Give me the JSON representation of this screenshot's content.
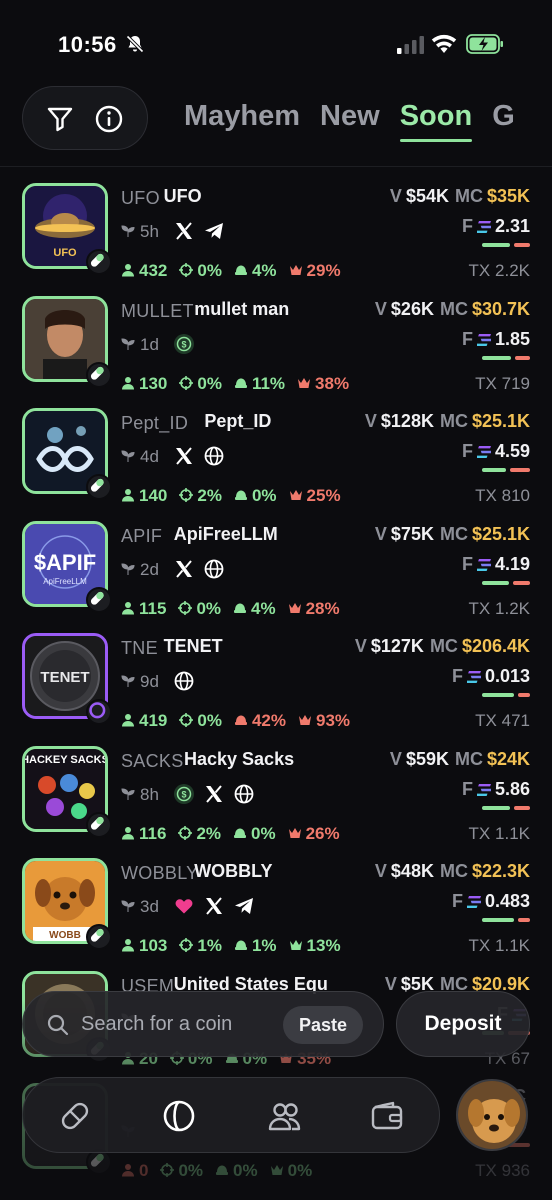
{
  "status_bar": {
    "time": "10:56"
  },
  "header": {
    "tabs": [
      "Mayhem",
      "New",
      "Soon",
      "G"
    ],
    "active_tab": "Soon"
  },
  "coins": [
    {
      "ticker": "UFO",
      "name": "UFO",
      "age": "5h",
      "socials": [
        "x-icon",
        "telegram-icon"
      ],
      "volume": "$54K",
      "mc": "$35K",
      "fee": "2.31",
      "holders": "432",
      "snipers": "0%",
      "insiders": "4%",
      "top10": "29%",
      "insiders_red": false,
      "top10_red": true,
      "tx": "2.2K",
      "border": "green",
      "bar_green": 0.62
    },
    {
      "ticker": "MULLET",
      "name": "mullet man",
      "age": "1d",
      "socials": [
        "dollar-icon"
      ],
      "volume": "$26K",
      "mc": "$30.7K",
      "fee": "1.85",
      "holders": "130",
      "snipers": "0%",
      "insiders": "11%",
      "top10": "38%",
      "insiders_red": false,
      "top10_red": true,
      "tx": "719",
      "border": "green",
      "bar_green": 0.65
    },
    {
      "ticker": "Pept_ID",
      "name": "Pept_ID",
      "age": "4d",
      "socials": [
        "x-icon",
        "globe-icon"
      ],
      "volume": "$128K",
      "mc": "$25.1K",
      "fee": "4.59",
      "holders": "140",
      "snipers": "2%",
      "insiders": "0%",
      "top10": "25%",
      "insiders_red": false,
      "top10_red": true,
      "tx": "810",
      "border": "green",
      "bar_green": 0.55
    },
    {
      "ticker": "APIF",
      "name": "ApiFreeLLM",
      "age": "2d",
      "socials": [
        "x-icon",
        "globe-icon"
      ],
      "volume": "$75K",
      "mc": "$25.1K",
      "fee": "4.19",
      "holders": "115",
      "snipers": "0%",
      "insiders": "4%",
      "top10": "28%",
      "insiders_red": false,
      "top10_red": true,
      "tx": "1.2K",
      "border": "green",
      "bar_green": 0.6
    },
    {
      "ticker": "TNE",
      "name": "TENET",
      "age": "9d",
      "socials": [
        "globe-icon"
      ],
      "volume": "$127K",
      "mc": "$206.4K",
      "fee": "0.013",
      "holders": "419",
      "snipers": "0%",
      "insiders": "42%",
      "top10": "93%",
      "insiders_red": true,
      "top10_red": true,
      "tx": "471",
      "border": "purple",
      "bar_green": 0.7
    },
    {
      "ticker": "SACKS",
      "name": "Hacky Sacks",
      "age": "8h",
      "socials": [
        "dollar-icon",
        "x-icon",
        "globe-icon"
      ],
      "volume": "$59K",
      "mc": "$24K",
      "fee": "5.86",
      "holders": "116",
      "snipers": "2%",
      "insiders": "0%",
      "top10": "26%",
      "insiders_red": false,
      "top10_red": true,
      "tx": "1.1K",
      "border": "green",
      "bar_green": 0.62
    },
    {
      "ticker": "WOBBLY",
      "name": "WOBBLY",
      "age": "3d",
      "socials": [
        "heart-icon",
        "x-icon",
        "telegram-icon"
      ],
      "volume": "$48K",
      "mc": "$22.3K",
      "fee": "0.483",
      "holders": "103",
      "snipers": "1%",
      "insiders": "1%",
      "top10": "13%",
      "insiders_red": false,
      "top10_red": false,
      "tx": "1.1K",
      "border": "green",
      "bar_green": 0.7
    },
    {
      "ticker": "USEM",
      "name": "United States Equ",
      "age": "",
      "socials": [],
      "volume": "$5K",
      "mc": "$20.9K",
      "fee": "",
      "holders": "20",
      "snipers": "0%",
      "insiders": "0%",
      "top10": "35%",
      "insiders_red": false,
      "top10_red": true,
      "tx": "67",
      "border": "green",
      "bar_green": 0.5
    },
    {
      "ticker": "",
      "name": "",
      "age": "",
      "socials": [],
      "volume": "",
      "mc": "",
      "fee": "",
      "holders": "0",
      "snipers": "0%",
      "insiders": "0%",
      "top10": "0%",
      "insiders_red": false,
      "top10_red": false,
      "tx": "936",
      "border": "green",
      "bar_green": 0.5,
      "holders_red": true
    }
  ],
  "labels": {
    "volume": "V",
    "mc": "MC",
    "fee": "F",
    "tx": "TX"
  },
  "search": {
    "placeholder": "Search for a coin",
    "paste": "Paste"
  },
  "deposit": "Deposit",
  "nav": [
    "pill-icon",
    "pump-icon",
    "users-icon",
    "wallet-icon"
  ],
  "colors": {
    "accent": "#8fe39c",
    "red": "#f07a6c",
    "gold": "#f3c255",
    "background": "#0c0c0f"
  }
}
